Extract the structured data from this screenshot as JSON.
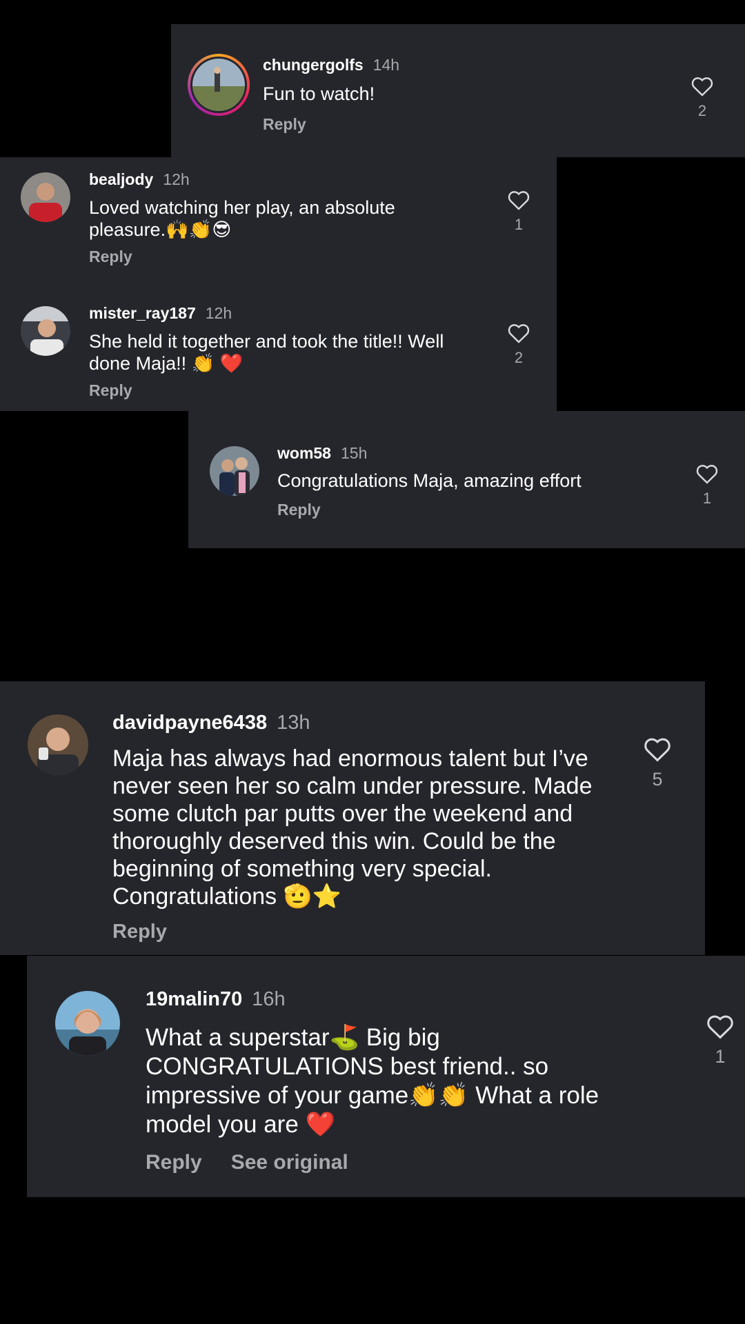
{
  "comments": [
    {
      "username": "chungergolfs",
      "time": "14h",
      "text": "Fun to watch!",
      "likes": "2",
      "reply": "Reply"
    },
    {
      "username": "bealjody",
      "time": "12h",
      "text": "Loved watching her play, an absolute pleasure.🙌👏😎",
      "likes": "1",
      "reply": "Reply"
    },
    {
      "username": "mister_ray187",
      "time": "12h",
      "text": "She held it together and took the title!! Well done Maja!! 👏 ❤️",
      "likes": "2",
      "reply": "Reply"
    },
    {
      "username": "wom58",
      "time": "15h",
      "text": "Congratulations Maja, amazing effort",
      "likes": "1",
      "reply": "Reply"
    },
    {
      "username": "davidpayne6438",
      "time": "13h",
      "text": "Maja has always had enormous talent but I’ve never seen her so calm under pressure. Made some clutch par putts over the weekend and thoroughly deserved this win. Could be the beginning of something very special. Congratulations 🫡⭐",
      "likes": "5",
      "reply": "Reply"
    },
    {
      "username": "19malin70",
      "time": "16h",
      "text": "What a superstar⛳ Big big CONGRATULATIONS best friend.. so impressive of your game👏👏 What a role model you are ❤️",
      "likes": "1",
      "reply": "Reply",
      "see_original": "See original"
    }
  ],
  "colors": {
    "background": "#000000",
    "card": "#25262b",
    "secondary_text": "#a8a9ad",
    "primary_text": "#ffffff"
  },
  "icons": {
    "like": "heart-outline-icon"
  }
}
